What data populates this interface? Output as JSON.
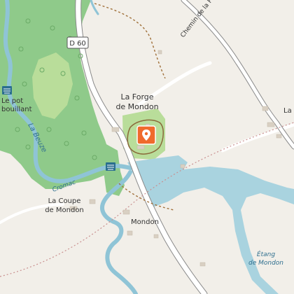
{
  "map": {
    "colors": {
      "land": "#f2efe9",
      "forest": "#8fca8a",
      "meadow": "#b9dd9a",
      "water": "#a9d3df",
      "river": "#8fc4d6",
      "road": "#ffffff",
      "road_casing": "#7e7e7e",
      "marker": "#f06a2c"
    },
    "labels": {
      "road_d60": "D 60",
      "chemin_forge": "Chemin de la Forge",
      "la_forge_line1": "La Forge",
      "la_forge_line2": "de Mondon",
      "le_pot_line1": "Le pot",
      "le_pot_line2": "bouillant",
      "river_name": "La Beuze",
      "cromac": "Cromac",
      "la_coupe_line1": "La Coupe",
      "la_coupe_line2": "de Mondon",
      "mondon": "Mondon",
      "etang_line1": "Étang",
      "etang_line2": "de Mondon",
      "la_v_partial": "La V"
    },
    "icons": {
      "marker": "location-pin-icon",
      "poi_water_1": "water-poi-icon",
      "poi_water_2": "water-poi-icon"
    }
  }
}
